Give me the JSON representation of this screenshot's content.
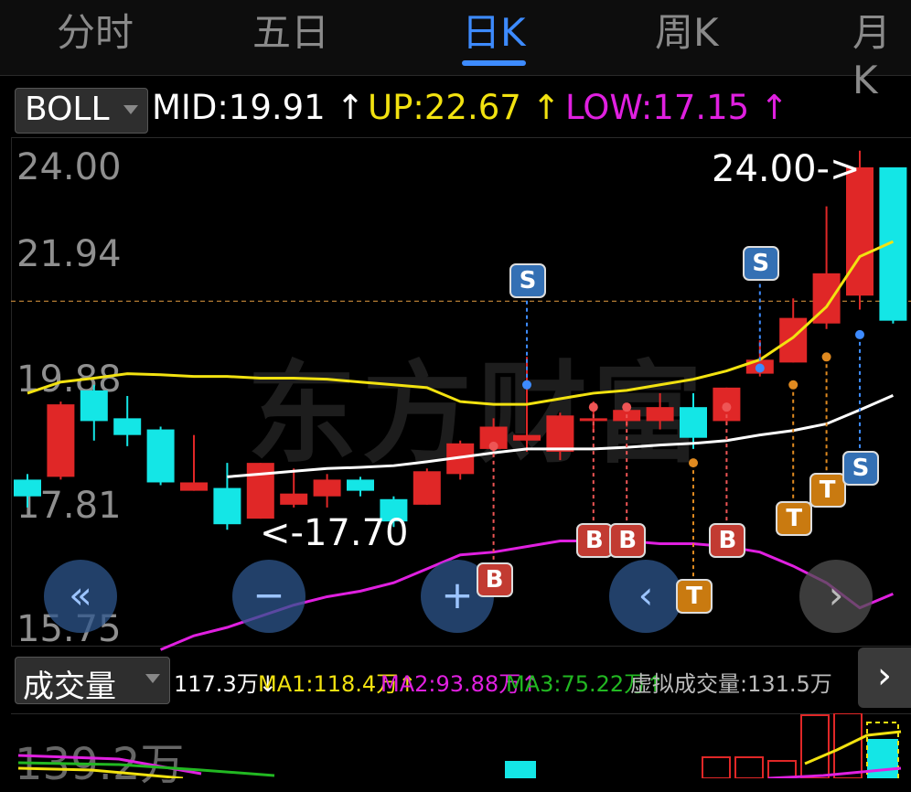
{
  "tabs": [
    {
      "label": "分时"
    },
    {
      "label": "五日"
    },
    {
      "label": "日K"
    },
    {
      "label": "周K"
    },
    {
      "label": "月K"
    }
  ],
  "indicator": {
    "name": "BOLL",
    "mid": "MID:19.91",
    "mid_arrow": "↑",
    "up": "UP:22.67",
    "up_arrow": "↑",
    "low": "LOW:17.15",
    "low_arrow": "↑"
  },
  "y_axis": [
    "24.00",
    "21.94",
    "19.88",
    "17.81",
    "15.75"
  ],
  "watermark": "东方财富",
  "price_notes": {
    "high": "24.00->",
    "low": "<-17.70"
  },
  "nav_buttons": [
    "«",
    "−",
    "+",
    "‹",
    "›"
  ],
  "volume": {
    "name": "成交量",
    "value": "117.3万",
    "value_arrow": "↓",
    "ma1": "MA1:118.4万",
    "ma1_arrow": "↑",
    "ma2": "MA2:93.88万",
    "ma2_arrow": "↑",
    "ma3": "MA3:75.22万",
    "ma3_arrow": "↑",
    "virtual": "虚拟成交量:131.5万",
    "axis_top": "139.2万",
    "more": "›"
  },
  "colors": {
    "active_tab": "#3d8bff",
    "up_candle": "#e02727",
    "down_candle": "#14e6e6",
    "mid_line": "#ffffff",
    "up_line": "#f2e210",
    "low_line": "#e020e0",
    "ma3": "#22b822"
  },
  "chart_data": {
    "type": "candlestick",
    "ylim": [
      15.75,
      24.0
    ],
    "candles": [
      {
        "o": 18.4,
        "c": 18.1,
        "h": 18.5,
        "l": 17.9
      },
      {
        "o": 18.45,
        "c": 19.75,
        "h": 19.8,
        "l": 18.4
      },
      {
        "o": 20.0,
        "c": 19.45,
        "h": 20.1,
        "l": 19.1
      },
      {
        "o": 19.5,
        "c": 19.2,
        "h": 19.9,
        "l": 19.0
      },
      {
        "o": 19.3,
        "c": 18.35,
        "h": 19.35,
        "l": 18.3
      },
      {
        "o": 18.2,
        "c": 18.35,
        "h": 19.2,
        "l": 18.2
      },
      {
        "o": 18.25,
        "c": 17.6,
        "h": 18.7,
        "l": 17.5
      },
      {
        "o": 17.7,
        "c": 18.7,
        "h": 18.7,
        "l": 17.7
      },
      {
        "o": 17.95,
        "c": 18.15,
        "h": 18.6,
        "l": 17.9
      },
      {
        "o": 18.1,
        "c": 18.4,
        "h": 18.5,
        "l": 17.9
      },
      {
        "o": 18.4,
        "c": 18.2,
        "h": 18.45,
        "l": 18.1
      },
      {
        "o": 18.05,
        "c": 17.65,
        "h": 18.1,
        "l": 17.55
      },
      {
        "o": 17.95,
        "c": 18.55,
        "h": 18.6,
        "l": 17.95
      },
      {
        "o": 18.5,
        "c": 19.05,
        "h": 19.1,
        "l": 18.4
      },
      {
        "o": 18.95,
        "c": 19.35,
        "h": 19.5,
        "l": 18.8
      },
      {
        "o": 19.1,
        "c": 19.2,
        "h": 20.6,
        "l": 18.9
      },
      {
        "o": 18.9,
        "c": 19.55,
        "h": 19.6,
        "l": 18.75
      },
      {
        "o": 19.45,
        "c": 19.5,
        "h": 19.8,
        "l": 19.25
      },
      {
        "o": 19.45,
        "c": 19.65,
        "h": 19.75,
        "l": 19.35
      },
      {
        "o": 19.45,
        "c": 19.7,
        "h": 19.95,
        "l": 19.3
      },
      {
        "o": 19.7,
        "c": 19.15,
        "h": 19.95,
        "l": 18.95
      },
      {
        "o": 19.45,
        "c": 20.05,
        "h": 20.05,
        "l": 19.4
      },
      {
        "o": 20.3,
        "c": 20.55,
        "h": 20.9,
        "l": 20.25
      },
      {
        "o": 20.5,
        "c": 21.3,
        "h": 21.65,
        "l": 20.5
      },
      {
        "o": 21.2,
        "c": 22.1,
        "h": 23.3,
        "l": 21.1
      },
      {
        "o": 21.7,
        "c": 24.0,
        "h": 24.3,
        "l": 21.45
      },
      {
        "o": 24.0,
        "c": 21.25,
        "h": 24.0,
        "l": 21.2
      }
    ],
    "boll_mid": [
      null,
      null,
      null,
      null,
      null,
      null,
      18.45,
      18.5,
      18.55,
      18.6,
      18.62,
      18.65,
      18.72,
      18.8,
      18.88,
      18.95,
      18.95,
      18.95,
      18.98,
      19.02,
      19.05,
      19.1,
      19.2,
      19.28,
      19.4,
      19.65,
      19.91
    ],
    "boll_up": [
      19.95,
      20.15,
      20.22,
      20.3,
      20.28,
      20.25,
      20.25,
      20.22,
      20.22,
      20.2,
      20.15,
      20.1,
      20.05,
      19.8,
      19.75,
      19.75,
      19.85,
      19.95,
      20.0,
      20.1,
      20.2,
      20.35,
      20.55,
      20.95,
      21.5,
      22.4,
      22.67
    ],
    "boll_low": [
      null,
      null,
      null,
      null,
      15.35,
      15.6,
      15.75,
      15.95,
      16.15,
      16.3,
      16.4,
      16.55,
      16.8,
      17.05,
      17.1,
      17.2,
      17.3,
      17.3,
      17.3,
      17.25,
      17.25,
      17.2,
      17.1,
      16.85,
      16.55,
      16.1,
      16.35
    ],
    "signals": [
      {
        "i": 14,
        "label": "B",
        "kind": "b",
        "price": 19.0,
        "pos": "below"
      },
      {
        "i": 15,
        "label": "S",
        "kind": "s",
        "price": 20.1,
        "pos": "above"
      },
      {
        "i": 17,
        "label": "B",
        "kind": "b",
        "price": 19.7,
        "pos": "below"
      },
      {
        "i": 18,
        "label": "B",
        "kind": "b",
        "price": 19.7,
        "pos": "below"
      },
      {
        "i": 20,
        "label": "T",
        "kind": "t",
        "price": 18.7,
        "pos": "below"
      },
      {
        "i": 21,
        "label": "B",
        "kind": "b",
        "price": 19.7,
        "pos": "below"
      },
      {
        "i": 22,
        "label": "S",
        "kind": "s",
        "price": 20.4,
        "pos": "above"
      },
      {
        "i": 23,
        "label": "T",
        "kind": "t",
        "price": 20.1,
        "pos": "below"
      },
      {
        "i": 24,
        "label": "T",
        "kind": "t",
        "price": 20.6,
        "pos": "below"
      },
      {
        "i": 25,
        "label": "S",
        "kind": "s",
        "price": 21.0,
        "pos": "below"
      }
    ],
    "reference_line": 21.6
  }
}
